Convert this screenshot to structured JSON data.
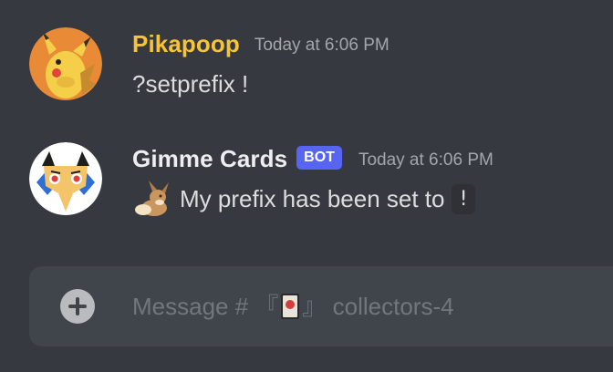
{
  "messages": [
    {
      "author": "Pikapoop",
      "timestamp": "Today at 6:06 PM",
      "text": "?setprefix !",
      "avatar_icon": "pikachu-avatar-icon",
      "author_color": "#f8c437"
    },
    {
      "author": "Gimme Cards",
      "tag": "BOT",
      "timestamp": "Today at 6:06 PM",
      "text": "My prefix has been set to",
      "code": "!",
      "emoji_icon": "eevee-emoji-icon",
      "avatar_icon": "gimme-cards-avatar-icon",
      "tag_color": "#5865f2"
    }
  ],
  "composer": {
    "placeholder_prefix": "Message # 『",
    "placeholder_suffix": "』 collectors-4",
    "channel_icon": "card-icon",
    "add_icon": "plus-circle-icon"
  },
  "theme": {
    "background": "#36393f",
    "input_background": "#40444b",
    "text": "#dcddde",
    "muted": "#72767d"
  }
}
